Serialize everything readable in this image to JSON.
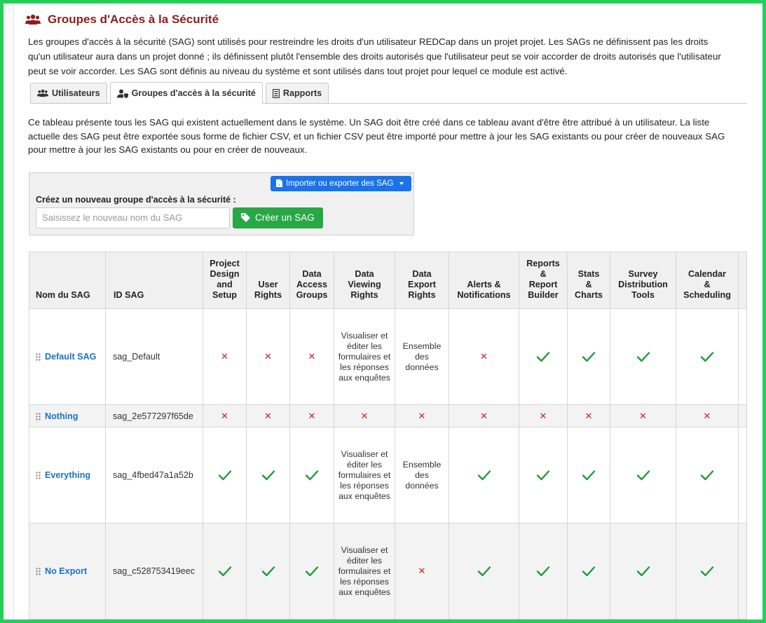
{
  "page": {
    "title": "Groupes d'Accès à la Sécurité",
    "intro": "Les groupes d'accès à la sécurité (SAG) sont utilisés pour restreindre les droits d'un utilisateur REDCap dans un projet projet. Les SAGs ne définissent pas les droits qu'un utilisateur aura dans un projet donné ; ils définissent plutôt l'ensemble des droits autorisés que l'utilisateur peut se voir accorder de droits autorisés que l'utilisateur peut se voir accorder. Les SAG sont définis au niveau du système et sont utilisés dans tout projet pour lequel ce module est activé."
  },
  "tabs": [
    {
      "label": "Utilisateurs",
      "icon": "users-icon",
      "active": false
    },
    {
      "label": "Groupes d'accès à la sécurité",
      "icon": "user-shield-icon",
      "active": true
    },
    {
      "label": "Rapports",
      "icon": "report-icon",
      "active": false
    }
  ],
  "description": "Ce tableau présente tous les SAG qui existent actuellement dans le système. Un SAG doit être créé dans ce tableau avant d'être être attribué à un utilisateur. La liste actuelle des SAG peut être exportée sous forme de fichier CSV, et un fichier CSV peut être importé pour mettre à jour les SAG existants ou pour créer de nouveaux SAG pour mettre à jour les SAG existants ou pour en créer de nouveaux.",
  "create": {
    "import_export_label": "Importer ou exporter des SAG",
    "label": "Créez un nouveau groupe d'accès à la sécurité :",
    "input_placeholder": "Saisissez le nouveau nom du SAG",
    "input_value": "",
    "button_label": "Créer un SAG"
  },
  "colors": {
    "title": "#8b1d1d",
    "link": "#1a73c9",
    "primary": "#1a73e8",
    "success": "#28a745",
    "check": "#1e9b3a",
    "cross": "#cc2222",
    "frame": "#22d058"
  },
  "table": {
    "headers": [
      "Nom du SAG",
      "ID SAG",
      "Project Design and Setup",
      "User Rights",
      "Data Access Groups",
      "Data Viewing Rights",
      "Data Export Rights",
      "Alerts & Notifications",
      "Reports & Report Builder",
      "Stats & Charts",
      "Survey Distribution Tools",
      "Calendar & Scheduling"
    ],
    "header_lines": [
      [
        "Nom du SAG"
      ],
      [
        "ID SAG"
      ],
      [
        "Project",
        "Design",
        "and",
        "Setup"
      ],
      [
        "User",
        "Rights"
      ],
      [
        "Data",
        "Access",
        "Groups"
      ],
      [
        "Data",
        "Viewing",
        "Rights"
      ],
      [
        "Data",
        "Export",
        "Rights"
      ],
      [
        "Alerts &",
        "Notifications"
      ],
      [
        "Reports",
        "&",
        "Report",
        "Builder"
      ],
      [
        "Stats",
        "&",
        "Charts"
      ],
      [
        "Survey",
        "Distribution",
        "Tools"
      ],
      [
        "Calendar",
        "&",
        "Scheduling"
      ]
    ],
    "rows": [
      {
        "name": "Default SAG",
        "id": "sag_Default",
        "cells": [
          "no",
          "no",
          "no",
          "Visualiser et éditer les formulaires et les réponses aux enquêtes",
          "Ensemble des données",
          "no",
          "yes",
          "yes",
          "yes",
          "yes"
        ]
      },
      {
        "name": "Nothing",
        "id": "sag_2e577297f65de",
        "cells": [
          "no",
          "no",
          "no",
          "no",
          "no",
          "no",
          "no",
          "no",
          "no",
          "no"
        ]
      },
      {
        "name": "Everything",
        "id": "sag_4fbed47a1a52b",
        "cells": [
          "yes",
          "yes",
          "yes",
          "Visualiser et éditer les formulaires et les réponses aux enquêtes",
          "Ensemble des données",
          "yes",
          "yes",
          "yes",
          "yes",
          "yes"
        ]
      },
      {
        "name": "No Export",
        "id": "sag_c528753419eec",
        "cells": [
          "yes",
          "yes",
          "yes",
          "Visualiser et éditer les formulaires et les réponses aux enquêtes",
          "no",
          "yes",
          "yes",
          "yes",
          "yes",
          "yes"
        ]
      }
    ]
  }
}
